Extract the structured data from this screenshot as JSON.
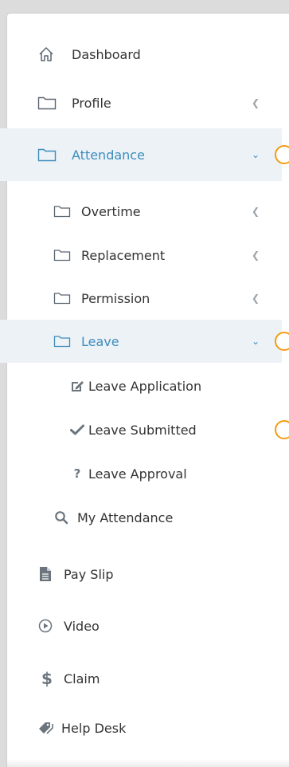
{
  "menu": {
    "dashboard": "Dashboard",
    "profile": "Profile",
    "attendance": "Attendance",
    "overtime": "Overtime",
    "replacement": "Replacement",
    "permission": "Permission",
    "leave": "Leave",
    "leave_application": "Leave Application",
    "leave_submitted": "Leave Submitted",
    "leave_approval": "Leave Approval",
    "my_attendance": "My Attendance",
    "pay_slip": "Pay Slip",
    "video": "Video",
    "claim": "Claim",
    "help_desk": "Help Desk"
  },
  "icons": {
    "dashboard": "home-icon",
    "profile": "folder-icon",
    "attendance": "folder-icon",
    "overtime": "folder-icon",
    "replacement": "folder-icon",
    "permission": "folder-icon",
    "leave": "folder-icon",
    "leave_application": "edit-icon",
    "leave_submitted": "check-icon",
    "leave_approval": "question-icon",
    "my_attendance": "search-icon",
    "pay_slip": "file-icon",
    "video": "play-circle-icon",
    "claim": "dollar-icon",
    "help_desk": "tag-icon"
  },
  "colors": {
    "accent": "#3c8dbc",
    "active_bg": "#edf2f7",
    "badge": "#f39c12",
    "text": "#333333"
  }
}
